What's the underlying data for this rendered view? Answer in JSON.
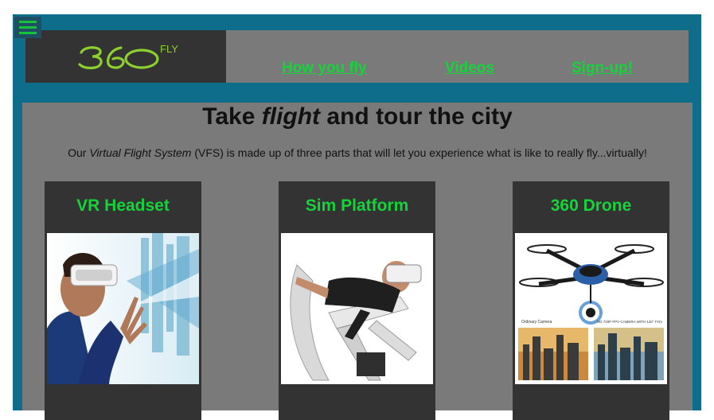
{
  "header": {
    "logo": {
      "number": "360",
      "suffix": "FLY"
    },
    "nav": [
      {
        "label": "How you fly"
      },
      {
        "label": "Videos"
      },
      {
        "label": "Sign-up!"
      }
    ]
  },
  "main": {
    "title_pre": "Take ",
    "title_em": "flight",
    "title_post": " and tour the city",
    "intro_pre": "Our ",
    "intro_em": "Virtual Flight System",
    "intro_post": " (VFS) is made up of three parts that will let you experience what is like to really fly...virtually!",
    "cards": [
      {
        "title": "VR Headset"
      },
      {
        "title": "Sim Platform"
      },
      {
        "title": "360 Drone"
      }
    ]
  },
  "drone_image": {
    "caption_left": "Ordinary Camera",
    "caption_right": "HD 720P FPV CAMERA WITH 120° FOV"
  },
  "colors": {
    "frame": "#0f6d8c",
    "panel": "#7a7a7a",
    "dark": "#333333",
    "accent_green": "#15d43a",
    "logo_green": "#8ccf2e"
  },
  "icons": [
    "hamburger-menu-icon"
  ]
}
